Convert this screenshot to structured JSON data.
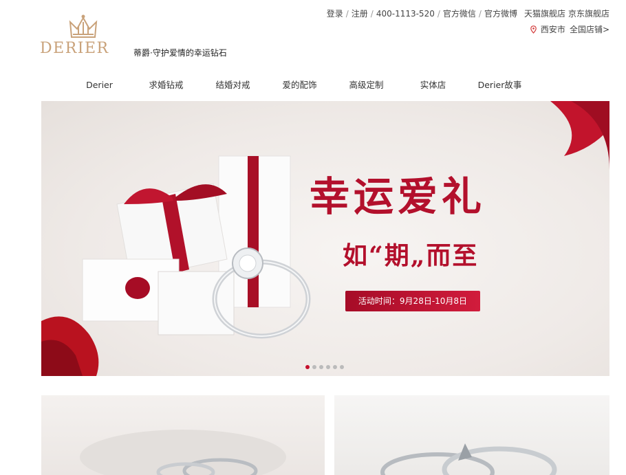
{
  "brand": {
    "name": "DERIER",
    "tagline": "蒂爵·守护爱情的幸运钻石"
  },
  "toplinks": {
    "login": "登录",
    "register": "注册",
    "phone": "400-1113-520",
    "wechat": "官方微信",
    "weibo": "官方微博",
    "tmall": "天猫旗舰店",
    "jd": "京东旗舰店"
  },
  "location": {
    "city": "西安市",
    "stores": "全国店铺>"
  },
  "nav": [
    {
      "label": "Derier"
    },
    {
      "label": "求婚钻戒"
    },
    {
      "label": "结婚对戒"
    },
    {
      "label": "爱的配饰"
    },
    {
      "label": "高级定制"
    },
    {
      "label": "实体店"
    },
    {
      "label": "Derier故事"
    }
  ],
  "banner": {
    "headline": "幸运爱礼",
    "subline": "如“期„而至",
    "date": "活动时间：9月28日-10月8日",
    "slide_count": 6,
    "active_slide": 1
  },
  "colors": {
    "brand_gold": "#c9a27a",
    "accent_red": "#b3102c"
  },
  "icons": [
    "crown-icon",
    "location-pin-icon"
  ]
}
